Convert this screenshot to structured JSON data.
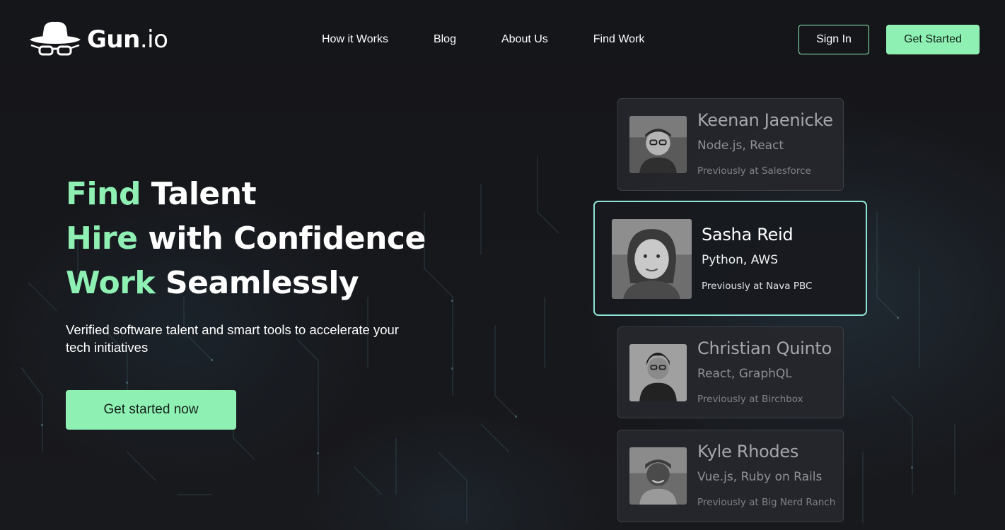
{
  "header": {
    "logo": {
      "icon": "hat-and-glasses-icon",
      "text_bold": "Gun",
      "text_light": ".io"
    },
    "nav": [
      {
        "label": "How it Works"
      },
      {
        "label": "Blog"
      },
      {
        "label": "About Us"
      },
      {
        "label": "Find Work"
      }
    ],
    "sign_in_label": "Sign In",
    "get_started_label": "Get Started"
  },
  "hero": {
    "lines": [
      {
        "accent": "Find",
        "rest": " Talent"
      },
      {
        "accent": "Hire",
        "rest": " with Confidence"
      },
      {
        "accent": "Work",
        "rest": " Seamlessly"
      }
    ],
    "subtitle": "Verified software talent and smart tools to accelerate your tech initiatives",
    "cta_label": "Get started now"
  },
  "talent": [
    {
      "name": "Keenan Jaenicke",
      "skills": "Node.js, React",
      "previously": "Previously at Salesforce"
    },
    {
      "name": "Sasha Reid",
      "skills": "Python, AWS",
      "previously": "Previously at Nava PBC"
    },
    {
      "name": "Christian Quinto",
      "skills": "React, GraphQL",
      "previously": "Previously at Birchbox"
    },
    {
      "name": "Kyle Rhodes",
      "skills": "Vue.js, Ruby on Rails",
      "previously": "Previously at Big Nerd Ranch"
    }
  ],
  "colors": {
    "accent": "#8ff0b4",
    "active_border": "#8fe3d6",
    "background": "#131417"
  }
}
